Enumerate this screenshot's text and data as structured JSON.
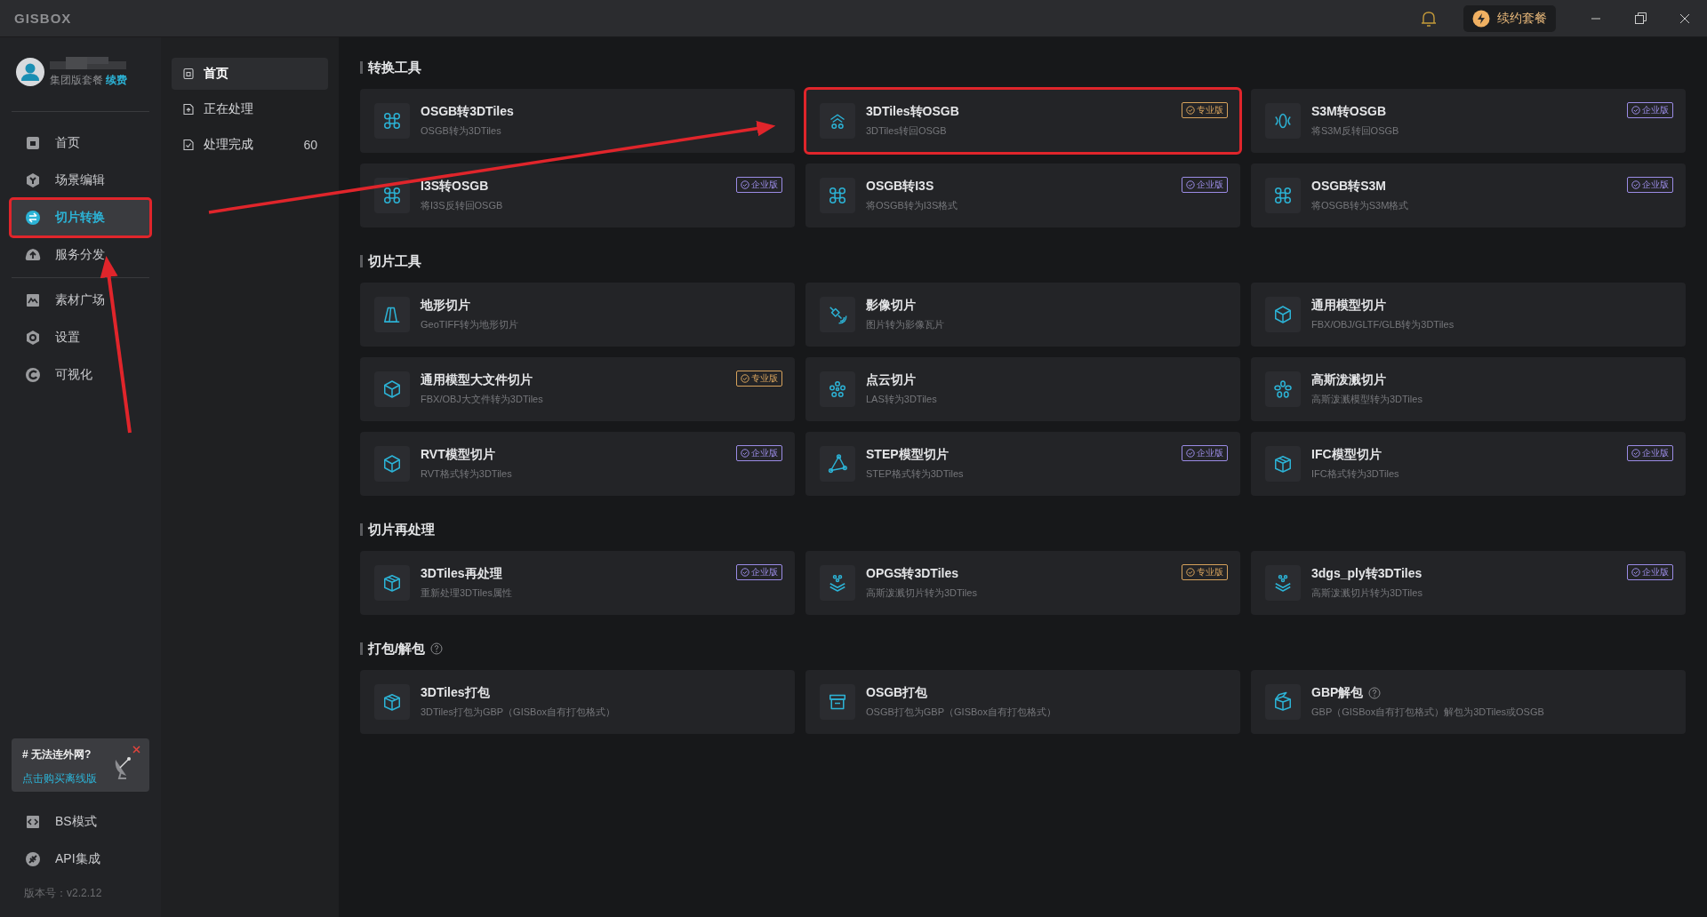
{
  "app": {
    "logo": "GISBOX",
    "renew": "续约套餐"
  },
  "user": {
    "plan": "集团版套餐",
    "renew_link": "续费"
  },
  "nav": [
    {
      "label": "首页",
      "selected": false,
      "highlighted": false
    },
    {
      "label": "场景编辑",
      "selected": false,
      "highlighted": false
    },
    {
      "label": "切片转换",
      "selected": true,
      "highlighted": true
    },
    {
      "label": "服务分发",
      "selected": false,
      "highlighted": false
    },
    {
      "label": "素材广场",
      "selected": false,
      "highlighted": false
    },
    {
      "label": "设置",
      "selected": false,
      "highlighted": false
    },
    {
      "label": "可视化",
      "selected": false,
      "highlighted": false
    }
  ],
  "promo": {
    "title": "# 无法连外网?",
    "link": "点击购买离线版"
  },
  "nav_bottom": [
    {
      "label": "BS模式"
    },
    {
      "label": "API集成"
    }
  ],
  "version": "版本号：v2.2.12",
  "subnav": [
    {
      "label": "首页",
      "selected": true
    },
    {
      "label": "正在处理",
      "selected": false
    },
    {
      "label": "处理完成",
      "selected": false,
      "count": "60"
    }
  ],
  "sections": [
    {
      "title": "转换工具",
      "cards": [
        {
          "title": "OSGB转3DTiles",
          "subtitle": "OSGB转为3DTiles",
          "highlighted": false
        },
        {
          "title": "3DTiles转OSGB",
          "subtitle": "3DTiles转回OSGB",
          "badge": {
            "text": "专业版",
            "color": "#d6a25c"
          },
          "highlighted": true
        },
        {
          "title": "S3M转OSGB",
          "subtitle": "将S3M反转回OSGB",
          "badge": {
            "text": "企业版",
            "color": "#9b8ce6"
          },
          "highlighted": false
        },
        {
          "title": "I3S转OSGB",
          "subtitle": "将I3S反转回OSGB",
          "badge": {
            "text": "企业版",
            "color": "#9b8ce6"
          },
          "highlighted": false
        },
        {
          "title": "OSGB转I3S",
          "subtitle": "将OSGB转为I3S格式",
          "badge": {
            "text": "企业版",
            "color": "#9b8ce6"
          },
          "highlighted": false
        },
        {
          "title": "OSGB转S3M",
          "subtitle": "将OSGB转为S3M格式",
          "badge": {
            "text": "企业版",
            "color": "#9b8ce6"
          },
          "highlighted": false
        }
      ]
    },
    {
      "title": "切片工具",
      "cards": [
        {
          "title": "地形切片",
          "subtitle": "GeoTIFF转为地形切片",
          "highlighted": false
        },
        {
          "title": "影像切片",
          "subtitle": "图片转为影像瓦片",
          "highlighted": false
        },
        {
          "title": "通用模型切片",
          "subtitle": "FBX/OBJ/GLTF/GLB转为3DTiles",
          "highlighted": false
        },
        {
          "title": "通用模型大文件切片",
          "subtitle": "FBX/OBJ大文件转为3DTiles",
          "badge": {
            "text": "专业版",
            "color": "#d6a25c"
          },
          "highlighted": false
        },
        {
          "title": "点云切片",
          "subtitle": "LAS转为3DTiles",
          "highlighted": false
        },
        {
          "title": "高斯泼溅切片",
          "subtitle": "高斯泼溅模型转为3DTiles",
          "highlighted": false
        },
        {
          "title": "RVT模型切片",
          "subtitle": "RVT格式转为3DTiles",
          "badge": {
            "text": "企业版",
            "color": "#9b8ce6"
          },
          "highlighted": false
        },
        {
          "title": "STEP模型切片",
          "subtitle": "STEP格式转为3DTiles",
          "badge": {
            "text": "企业版",
            "color": "#9b8ce6"
          },
          "highlighted": false
        },
        {
          "title": "IFC模型切片",
          "subtitle": "IFC格式转为3DTiles",
          "badge": {
            "text": "企业版",
            "color": "#9b8ce6"
          },
          "highlighted": false
        }
      ]
    },
    {
      "title": "切片再处理",
      "cards": [
        {
          "title": "3DTiles再处理",
          "subtitle": "重新处理3DTiles属性",
          "badge": {
            "text": "企业版",
            "color": "#9b8ce6"
          },
          "highlighted": false
        },
        {
          "title": "OPGS转3DTiles",
          "subtitle": "高斯泼溅切片转为3DTiles",
          "badge": {
            "text": "专业版",
            "color": "#d6a25c"
          },
          "highlighted": false
        },
        {
          "title": "3dgs_ply转3DTiles",
          "subtitle": "高斯泼溅切片转为3DTiles",
          "badge": {
            "text": "企业版",
            "color": "#9b8ce6"
          },
          "highlighted": false
        }
      ]
    },
    {
      "title": "打包/解包",
      "help": true,
      "cards": [
        {
          "title": "3DTiles打包",
          "subtitle": "3DTiles打包为GBP（GISBox自有打包格式）",
          "highlighted": false
        },
        {
          "title": "OSGB打包",
          "subtitle": "OSGB打包为GBP（GISBox自有打包格式）",
          "highlighted": false
        },
        {
          "title": "GBP解包",
          "subtitle": "GBP（GISBox自有打包格式）解包为3DTiles或OSGB",
          "help": true,
          "highlighted": false
        }
      ]
    }
  ]
}
